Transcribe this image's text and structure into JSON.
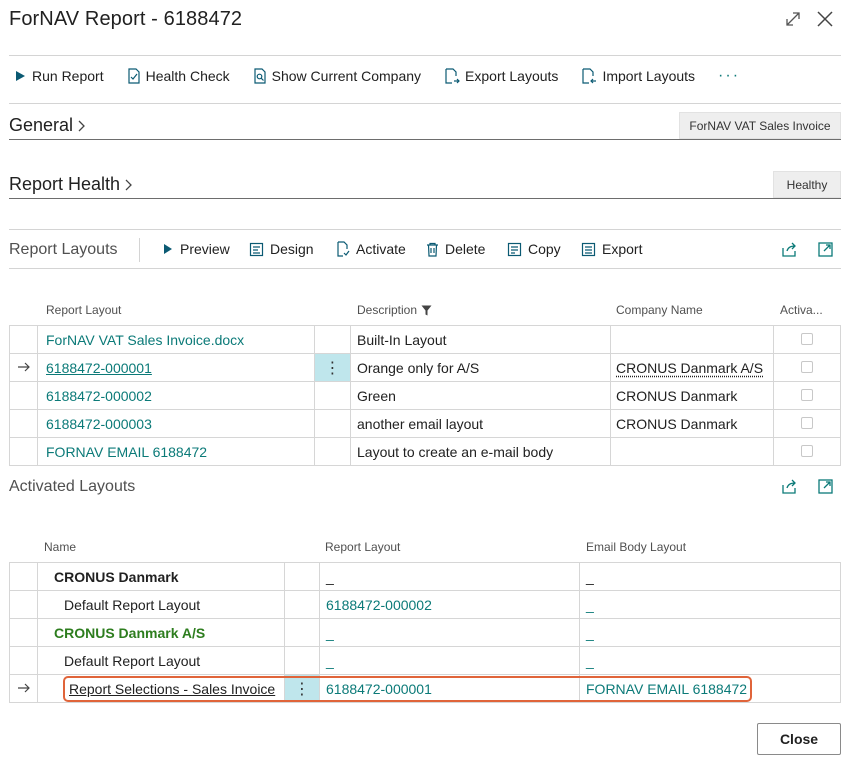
{
  "window": {
    "title": "ForNAV Report - 6188472"
  },
  "toolbar": {
    "run_report": "Run Report",
    "health_check": "Health Check",
    "show_current_company": "Show Current Company",
    "export_layouts": "Export Layouts",
    "import_layouts": "Import Layouts",
    "more": "···"
  },
  "general": {
    "title": "General",
    "badge": "ForNAV VAT Sales Invoice"
  },
  "report_health": {
    "title": "Report Health",
    "badge": "Healthy"
  },
  "report_layouts": {
    "title": "Report Layouts",
    "actions": {
      "preview": "Preview",
      "design": "Design",
      "activate": "Activate",
      "delete": "Delete",
      "copy": "Copy",
      "export": "Export"
    },
    "columns": {
      "report_layout": "Report Layout",
      "description": "Description",
      "company_name": "Company Name",
      "activated": "Activa..."
    },
    "rows": [
      {
        "layout": "ForNAV VAT Sales Invoice.docx",
        "description": "Built-In Layout",
        "company": ""
      },
      {
        "layout": "6188472-000001",
        "description": "Orange only for A/S",
        "company": "CRONUS Danmark A/S"
      },
      {
        "layout": "6188472-000002",
        "description": "Green",
        "company": "CRONUS Danmark"
      },
      {
        "layout": "6188472-000003",
        "description": "another email layout",
        "company": "CRONUS Danmark"
      },
      {
        "layout": "FORNAV EMAIL 6188472",
        "description": "Layout to create an e-mail body",
        "company": ""
      }
    ]
  },
  "activated_layouts": {
    "title": "Activated Layouts",
    "columns": {
      "name": "Name",
      "report_layout": "Report Layout",
      "email_body_layout": "Email Body Layout"
    },
    "rows": [
      {
        "name": "CRONUS Danmark",
        "layout": "_",
        "email": "_"
      },
      {
        "name": "Default Report Layout",
        "layout": "6188472-000002",
        "email": "_"
      },
      {
        "name": "CRONUS Danmark A/S",
        "layout": "_",
        "email": "_"
      },
      {
        "name": "Default Report Layout",
        "layout": "_",
        "email": "_"
      },
      {
        "name": "Report Selections - Sales Invoice",
        "layout": "6188472-000001",
        "email": "FORNAV EMAIL 6188472"
      }
    ]
  },
  "footer": {
    "close": "Close"
  },
  "icons": {
    "expand": "expand-icon",
    "close": "close-icon",
    "selected_row": "arrow-right-icon",
    "filter": "filter-icon",
    "share": "share-icon",
    "popout": "open-in-new-window-icon"
  },
  "colors": {
    "accent": "#0b7a78",
    "highlight": "#e0643a",
    "row_menu": "#bfe6ec",
    "company_green": "#2d7d1e"
  }
}
